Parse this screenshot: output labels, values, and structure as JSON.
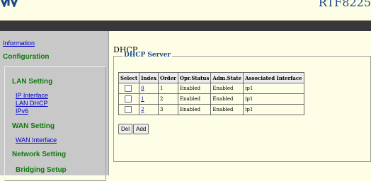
{
  "header": {
    "model": "RTF8225"
  },
  "sidebar": {
    "information": "Information",
    "configuration": "Configuration",
    "lan_setting": "LAN Setting",
    "ip_interface": "IP Interface",
    "lan_dhcp": "LAN DHCP",
    "ipv6": "IPv6",
    "wan_setting": "WAN Setting",
    "wan_interface": "WAN Interface",
    "network_setting": "Network Setting",
    "bridging_setup": "Bridging Setup"
  },
  "main": {
    "title": "DHCP",
    "legend": "DHCP Server",
    "columns": [
      "Select",
      "Index",
      "Order",
      "Opr.Status",
      "Adm.State",
      "Associated Interface"
    ],
    "rows": [
      {
        "index": "0",
        "order": "1",
        "opr": "Enabled",
        "adm": "Enabled",
        "iface": "ip1"
      },
      {
        "index": "1",
        "order": "2",
        "opr": "Enabled",
        "adm": "Enabled",
        "iface": "ip1"
      },
      {
        "index": "2",
        "order": "3",
        "opr": "Enabled",
        "adm": "Enabled",
        "iface": "ip1"
      }
    ],
    "buttons": {
      "del": "Del",
      "add": "Add"
    }
  },
  "colors": {
    "page_bg": "#fefee6",
    "dark_bar": "#38383a",
    "sidebar_bg": "#c8c8c8",
    "nav_green": "#0e7a0e",
    "brand_blue": "#1e4b8c"
  }
}
